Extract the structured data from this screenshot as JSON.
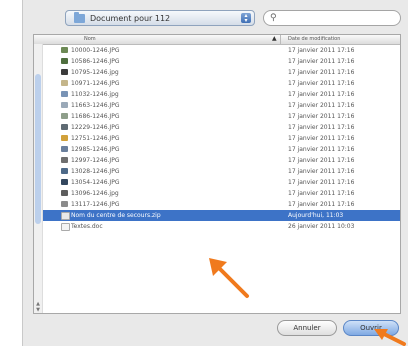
{
  "toolbar": {
    "folder_popup_label": "Document pour 112",
    "search_placeholder": "",
    "icons": {
      "folder": "folder-icon",
      "search": "magnifier-icon",
      "stepper": "popup-stepper-icon"
    }
  },
  "list": {
    "columns": {
      "name": "Nom",
      "date": "Date de modification"
    },
    "rows": [
      {
        "name": "10000-1246.JPG",
        "date": "17 janvier 2011 17:16",
        "icon_color": "#6d8a55"
      },
      {
        "name": "10586-1246.JPG",
        "date": "17 janvier 2011 17:16",
        "icon_color": "#4f6f3f"
      },
      {
        "name": "10795-1246.jpg",
        "date": "17 janvier 2011 17:16",
        "icon_color": "#3b3b3b"
      },
      {
        "name": "10971-1246.JPG",
        "date": "17 janvier 2011 17:16",
        "icon_color": "#c4b58a"
      },
      {
        "name": "11032-1246.jpg",
        "date": "17 janvier 2011 17:16",
        "icon_color": "#7893b5"
      },
      {
        "name": "11663-1246.JPG",
        "date": "17 janvier 2011 17:16",
        "icon_color": "#9aa9b8"
      },
      {
        "name": "11686-1246.JPG",
        "date": "17 janvier 2011 17:16",
        "icon_color": "#8e9e8a"
      },
      {
        "name": "12229-1246.JPG",
        "date": "17 janvier 2011 17:16",
        "icon_color": "#5f6b73"
      },
      {
        "name": "12751-1246.JPG",
        "date": "17 janvier 2011 17:16",
        "icon_color": "#d1a13a"
      },
      {
        "name": "12985-1246.JPG",
        "date": "17 janvier 2011 17:16",
        "icon_color": "#6a7f9c"
      },
      {
        "name": "12997-1246.JPG",
        "date": "17 janvier 2011 17:16",
        "icon_color": "#6f6f6f"
      },
      {
        "name": "13028-1246.JPG",
        "date": "17 janvier 2011 17:16",
        "icon_color": "#4e6a89"
      },
      {
        "name": "13054-1246.JPG",
        "date": "17 janvier 2011 17:16",
        "icon_color": "#33475e"
      },
      {
        "name": "13096-1246.jpg",
        "date": "17 janvier 2011 17:16",
        "icon_color": "#5d5d5d"
      },
      {
        "name": "13117-1246.JPG",
        "date": "17 janvier 2011 17:16",
        "icon_color": "#8b8b8b"
      },
      {
        "name": "Nom du centre de secours.zip",
        "date": "Aujourd'hui, 11:03",
        "icon_color": "#e9e9e9",
        "selected": true
      },
      {
        "name": "Textes.doc",
        "date": "26 janvier 2011 10:03",
        "icon_color": "#f4f4f4"
      }
    ]
  },
  "buttons": {
    "cancel": "Annuler",
    "open": "Ouvrir"
  },
  "colors": {
    "selection": "#3d73c7",
    "annotation_arrow": "#f07a1d"
  }
}
